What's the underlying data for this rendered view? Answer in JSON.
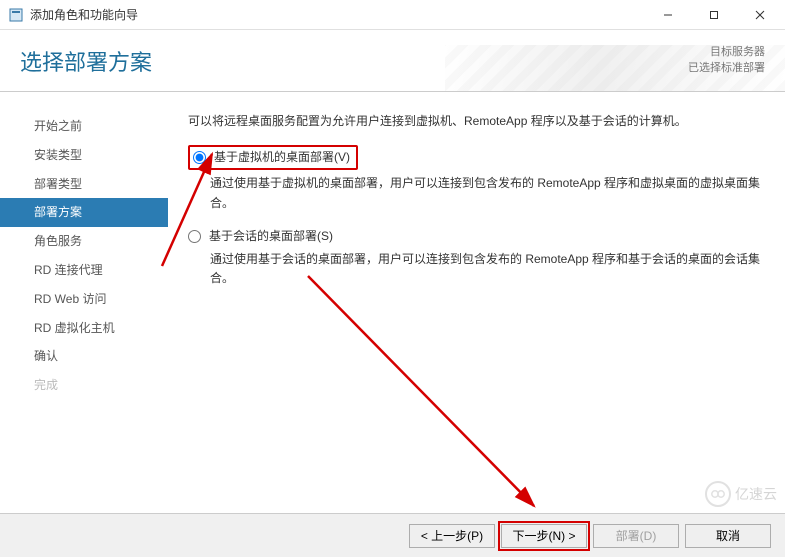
{
  "window": {
    "title": "添加角色和功能向导"
  },
  "header": {
    "page_title": "选择部署方案",
    "server_label": "目标服务器",
    "server_value": "已选择标准部署"
  },
  "sidebar": {
    "items": [
      {
        "label": "开始之前",
        "state": "normal"
      },
      {
        "label": "安装类型",
        "state": "normal"
      },
      {
        "label": "部署类型",
        "state": "normal"
      },
      {
        "label": "部署方案",
        "state": "current"
      },
      {
        "label": "角色服务",
        "state": "normal"
      },
      {
        "label": "RD 连接代理",
        "state": "normal"
      },
      {
        "label": "RD Web 访问",
        "state": "normal"
      },
      {
        "label": "RD 虚拟化主机",
        "state": "normal"
      },
      {
        "label": "确认",
        "state": "normal"
      },
      {
        "label": "完成",
        "state": "disabled"
      }
    ]
  },
  "content": {
    "intro": "可以将远程桌面服务配置为允许用户连接到虚拟机、RemoteApp 程序以及基于会话的计算机。",
    "option1": {
      "label": "基于虚拟机的桌面部署(V)",
      "desc": "通过使用基于虚拟机的桌面部署，用户可以连接到包含发布的 RemoteApp 程序和虚拟桌面的虚拟桌面集合。"
    },
    "option2": {
      "label": "基于会话的桌面部署(S)",
      "desc": "通过使用基于会话的桌面部署，用户可以连接到包含发布的 RemoteApp 程序和基于会话的桌面的会话集合。"
    }
  },
  "footer": {
    "prev": "< 上一步(P)",
    "next": "下一步(N) >",
    "deploy": "部署(D)",
    "cancel": "取消"
  },
  "watermark": {
    "text": "亿速云"
  }
}
